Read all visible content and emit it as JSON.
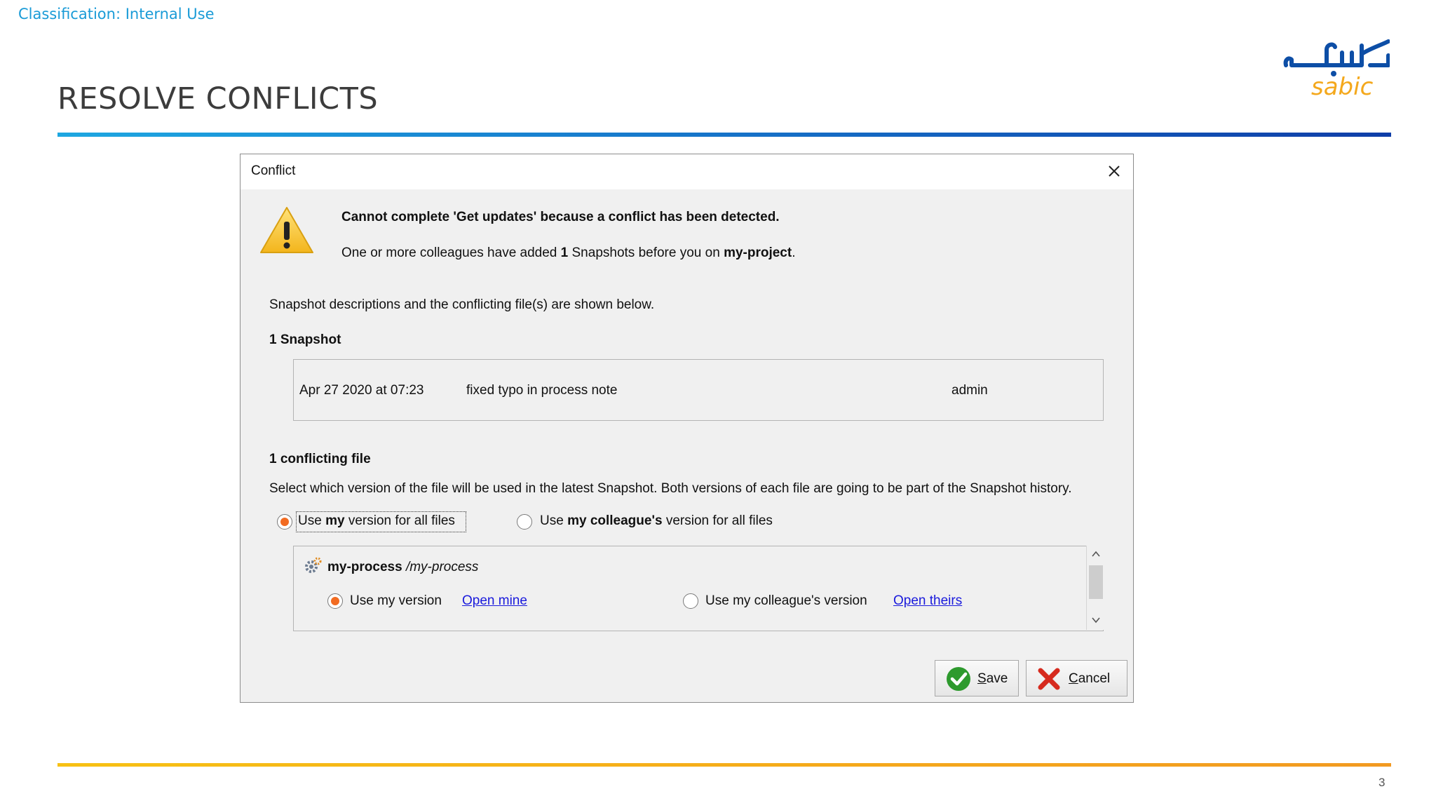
{
  "slide": {
    "classification": "Classification: Internal Use",
    "title": "RESOLVE CONFLICTS",
    "logo_text": "sabic",
    "page_number": "3",
    "colors": {
      "accent_blue": "#1a9bd7",
      "rule_gold": "#f5a91b",
      "logo_blue": "#0d4ea6",
      "logo_orange": "#f4a81c"
    }
  },
  "dialog": {
    "title": "Conflict",
    "headline": "Cannot complete 'Get updates' because a conflict has been detected.",
    "info": {
      "prefix": "One or more colleagues have added ",
      "count": "1",
      "middle": " Snapshots before you on ",
      "project": "my-project",
      "suffix": "."
    },
    "description": "Snapshot descriptions and the conflicting file(s) are shown below.",
    "snapshot_section": {
      "count": "1",
      "label": "Snapshot"
    },
    "snapshot": {
      "date": "Apr 27 2020 at 07:23",
      "message": "fixed typo in process note",
      "author": "admin"
    },
    "conflicts_section": {
      "count": "1",
      "label": "conflicting file"
    },
    "select_help": "Select which version of the file will be used in the latest Snapshot. Both versions of each file are going to be part of the Snapshot history.",
    "global_options": {
      "mine": {
        "pre": "Use ",
        "bold": "my",
        "post": " version for all files",
        "selected": true
      },
      "theirs": {
        "pre": "Use ",
        "bold": "my colleague's",
        "post": " version for all files",
        "selected": false
      }
    },
    "file": {
      "name": "my-process",
      "path": "/my-process",
      "icon": "process-gear-icon",
      "use_mine": "Use my version",
      "open_mine": "Open mine",
      "use_theirs": "Use my colleague's version",
      "open_theirs": "Open theirs",
      "selected": "mine"
    },
    "buttons": {
      "save": {
        "mnemonic": "S",
        "rest": "ave"
      },
      "cancel": {
        "mnemonic": "C",
        "rest": "ancel"
      }
    }
  }
}
